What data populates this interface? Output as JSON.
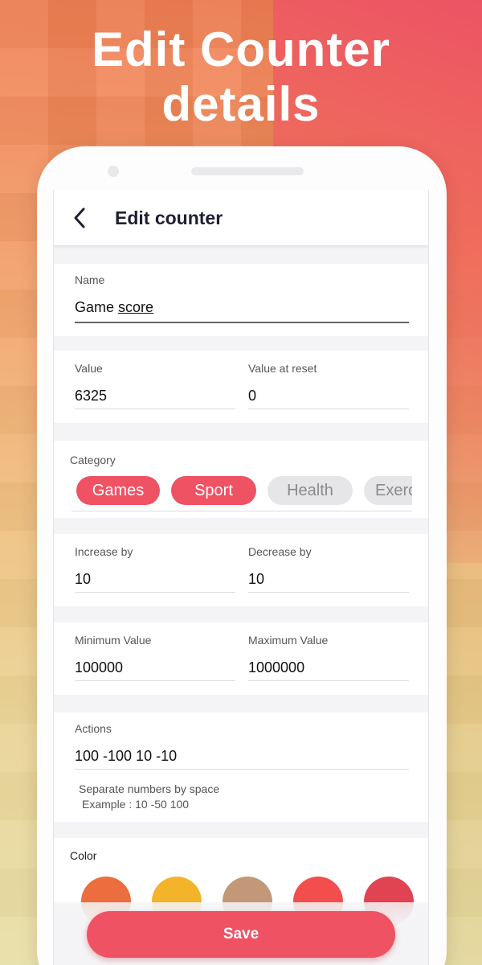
{
  "headline": {
    "line1": "Edit Counter",
    "line2": "details"
  },
  "appbar": {
    "title": "Edit counter"
  },
  "name": {
    "label": "Name",
    "value_word1": "Game",
    "value_word2": "score"
  },
  "value": {
    "label": "Value",
    "value": "6325"
  },
  "value_at_reset": {
    "label": "Value at reset",
    "value": "0"
  },
  "category": {
    "label": "Category",
    "chips": [
      {
        "label": "Games",
        "selected": true
      },
      {
        "label": "Sport",
        "selected": true
      },
      {
        "label": "Health",
        "selected": false
      },
      {
        "label": "Exercise",
        "selected": false
      }
    ]
  },
  "increase_by": {
    "label": "Increase by",
    "value": "10"
  },
  "decrease_by": {
    "label": "Decrease by",
    "value": "10"
  },
  "minimum_value": {
    "label": "Minimum Value",
    "value": "100000"
  },
  "maximum_value": {
    "label": "Maximum Value",
    "value": "1000000"
  },
  "actions": {
    "label": "Actions",
    "value": "100 -100 10 -10",
    "helper_line1": "Separate numbers by space",
    "helper_line2": "Example : 10 -50 100"
  },
  "color": {
    "label": "Color",
    "swatches": [
      "#ec6d3d",
      "#f3b42a",
      "#c29878",
      "#f24e4e",
      "#e04352"
    ]
  },
  "save": {
    "label": "Save"
  },
  "colors": {
    "accent": "#ef5263",
    "chip_inactive": "#e6e6e8"
  }
}
